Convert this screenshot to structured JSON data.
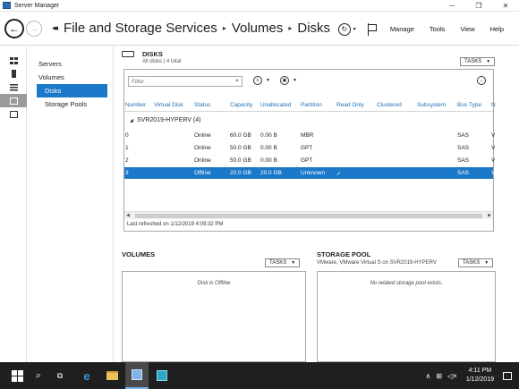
{
  "window": {
    "title": "Server Manager",
    "controls": [
      "─",
      "❐",
      "✕"
    ]
  },
  "header": {
    "lead": "◂◂",
    "breadcrumb": [
      "File and Storage Services",
      "Volumes",
      "Disks"
    ],
    "menu": [
      "Manage",
      "Tools",
      "View",
      "Help"
    ]
  },
  "nav": {
    "items": [
      {
        "label": "Servers"
      },
      {
        "label": "Volumes"
      },
      {
        "label": "Disks"
      },
      {
        "label": "Storage Pools"
      }
    ]
  },
  "disks": {
    "title": "DISKS",
    "subtitle": "All disks | 4 total",
    "tasks_label": "TASKS",
    "filter_placeholder": "Filter",
    "columns": [
      "Number",
      "Virtual Disk",
      "Status",
      "Capacity",
      "Unallocated",
      "Partition",
      "Read Only",
      "Clustered",
      "Subsystem",
      "Bus Type",
      "N"
    ],
    "group_label": "SVR2019-HYPERV (4)",
    "rows": [
      {
        "number": "0",
        "virtual_disk": "",
        "status": "Online",
        "capacity": "60.0 GB",
        "unallocated": "0.00 B",
        "partition": "MBR",
        "read_only": "",
        "clustered": "",
        "subsystem": "",
        "bus_type": "SAS",
        "name": "V"
      },
      {
        "number": "1",
        "virtual_disk": "",
        "status": "Online",
        "capacity": "50.0 GB",
        "unallocated": "0.00 B",
        "partition": "GPT",
        "read_only": "",
        "clustered": "",
        "subsystem": "",
        "bus_type": "SAS",
        "name": "V"
      },
      {
        "number": "2",
        "virtual_disk": "",
        "status": "Online",
        "capacity": "50.0 GB",
        "unallocated": "0.00 B",
        "partition": "GPT",
        "read_only": "",
        "clustered": "",
        "subsystem": "",
        "bus_type": "SAS",
        "name": "V"
      },
      {
        "number": "3",
        "virtual_disk": "",
        "status": "Offline",
        "capacity": "20.0 GB",
        "unallocated": "20.0 GB",
        "partition": "Unknown",
        "read_only": "✓",
        "clustered": "",
        "subsystem": "",
        "bus_type": "SAS",
        "name": "V"
      }
    ],
    "selected_row": 3,
    "status_text": "Last refreshed on 1/12/2019 4:09:32 PM"
  },
  "volumes": {
    "title": "VOLUMES",
    "tasks_label": "TASKS",
    "empty_text": "Disk is Offline"
  },
  "storage_pool": {
    "title": "STORAGE POOL",
    "subtitle": "VMware, VMware Virtual S on SVR2019-HYPERV",
    "tasks_label": "TASKS",
    "empty_text": "No related storage pool exists."
  },
  "taskbar": {
    "time": "4:11 PM",
    "date": "1/12/2019"
  },
  "colors": {
    "accent": "#1c78c8",
    "header_text": "#1f6fb3",
    "taskbar": "#1f1f1f"
  }
}
